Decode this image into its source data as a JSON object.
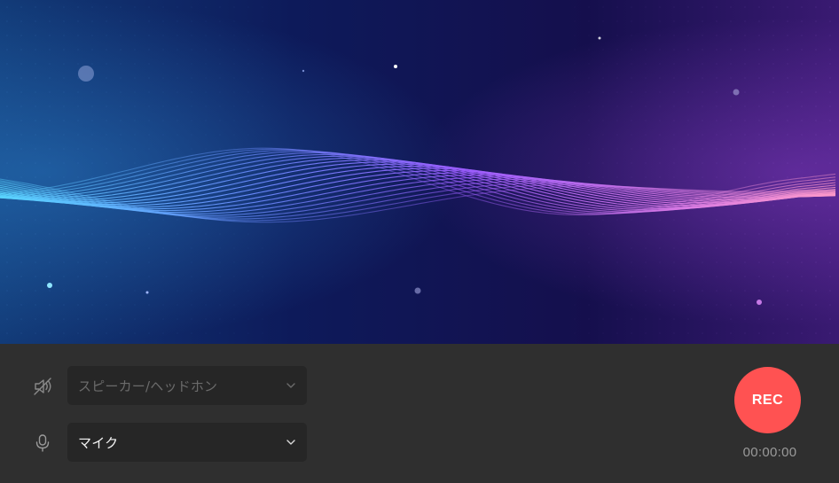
{
  "audio": {
    "speaker_select": {
      "value": "スピーカー/ヘッドホン",
      "enabled": false
    },
    "mic_select": {
      "value": "マイク",
      "enabled": true
    }
  },
  "recorder": {
    "rec_label": "REC",
    "elapsed": "00:00:00"
  },
  "colors": {
    "accent_rec": "#ff5252",
    "wave_left": "#59d4ff",
    "wave_mid": "#8a5cff",
    "wave_right": "#ff8fd0",
    "bg_panel": "#2f2f2f"
  },
  "icons": {
    "speaker": "speaker-muted-icon",
    "mic": "microphone-icon",
    "dropdown": "chevron-down-icon"
  }
}
